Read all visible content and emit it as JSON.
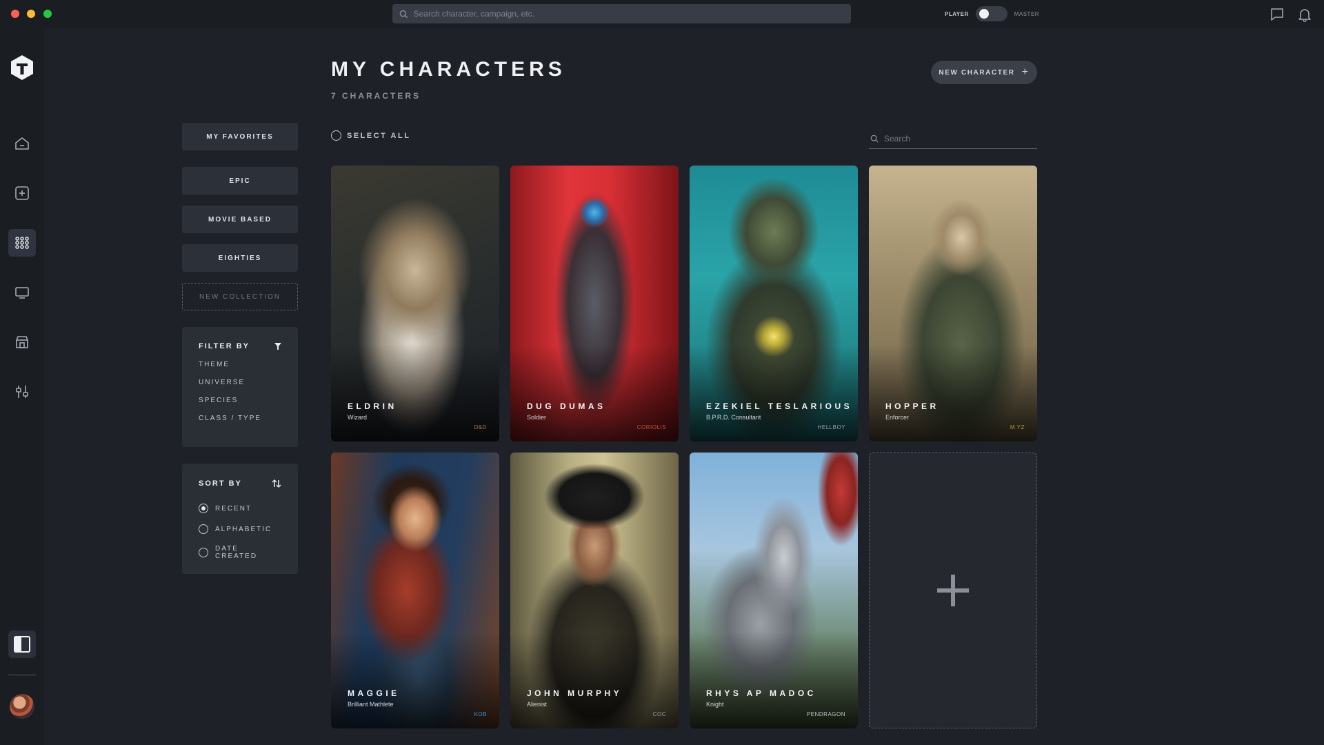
{
  "topbar": {
    "search_placeholder": "Search character, campaign, etc.",
    "mode_left": "PLAYER",
    "mode_right": "MASTER"
  },
  "header": {
    "title": "MY CHARACTERS",
    "subtitle": "7 CHARACTERS",
    "new_button": "NEW CHARACTER"
  },
  "collections": {
    "items": [
      "MY FAVORITES",
      "EPIC",
      "MOVIE BASED",
      "EIGHTIES"
    ],
    "new_label": "NEW COLLECTION"
  },
  "filter": {
    "title": "FILTER BY",
    "items": [
      "THEME",
      "UNIVERSE",
      "SPECIES",
      "CLASS / TYPE"
    ]
  },
  "sort": {
    "title": "SORT BY",
    "options": [
      "RECENT",
      "ALPHABETIC",
      "DATE CREATED"
    ],
    "selected": "RECENT"
  },
  "toolbar": {
    "select_all": "SELECT ALL",
    "search_placeholder": "Search"
  },
  "characters": [
    {
      "name": "ELDRIN",
      "role": "Wizard",
      "system": "D&D",
      "system_color": "#b07a3a"
    },
    {
      "name": "DUG DUMAS",
      "role": "Soldier",
      "system": "CORIOLIS",
      "system_color": "#c25040"
    },
    {
      "name": "EZEKIEL TESLARIOUS",
      "role": "B.P.R.D. Consultant",
      "system": "HELLBOY",
      "system_color": "#9aa0a8"
    },
    {
      "name": "HOPPER",
      "role": "Enforcer",
      "system": "M.YZ",
      "system_color": "#b89a4a"
    },
    {
      "name": "MAGGIE",
      "role": "Brilliant Mathlete",
      "system": "KOB",
      "system_color": "#3a8fd0"
    },
    {
      "name": "JOHN MURPHY",
      "role": "Alienist",
      "system": "COC",
      "system_color": "#9aa0a8"
    },
    {
      "name": "RHYS AP MADOC",
      "role": "Knight",
      "system": "PENDRAGON",
      "system_color": "#bfc3c9"
    }
  ],
  "colors": {
    "background": "#1e2127",
    "rail": "#1a1d22",
    "panel": "#2a2e35",
    "button": "#2c3038"
  }
}
